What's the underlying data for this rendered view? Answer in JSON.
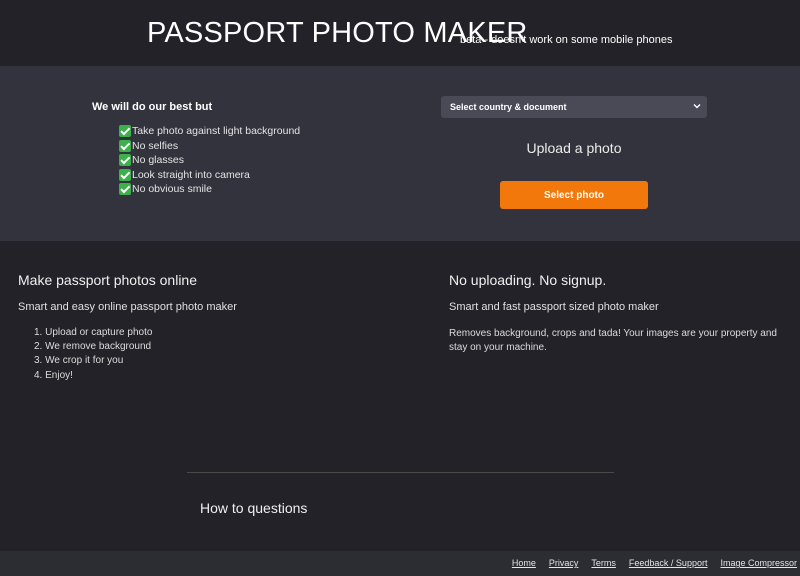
{
  "header": {
    "title": "PASSPORT PHOTO MAKER",
    "subtitle": "beta - doesn't work on some mobile phones"
  },
  "hero": {
    "intro": "We will do our best but",
    "tips": [
      "Take photo against light background",
      "No selfies",
      "No glasses",
      "Look straight into camera",
      "No obvious smile"
    ],
    "document_select": {
      "selected": "Select country & document",
      "icon": "chevron-down-icon"
    },
    "upload_title": "Upload a photo",
    "select_button": "Select photo",
    "colors": {
      "accent": "#f3780c",
      "check": "#3cb04a",
      "panel": "#33333d",
      "background": "#222228"
    }
  },
  "info": {
    "left": {
      "title": "Make passport photos online",
      "subtitle": "Smart and easy online passport photo maker",
      "steps": [
        "Upload or capture photo",
        "We remove background",
        "We crop it for you",
        "Enjoy!"
      ]
    },
    "right": {
      "title": "No uploading. No signup.",
      "subtitle": "Smart and fast passport sized photo maker",
      "description": "Removes background, crops and tada! Your images are your property and stay on your machine."
    }
  },
  "faq": {
    "title": "How to questions"
  },
  "footer": {
    "links": [
      "Home",
      "Privacy",
      "Terms",
      "Feedback / Support",
      "Image Compressor"
    ]
  }
}
